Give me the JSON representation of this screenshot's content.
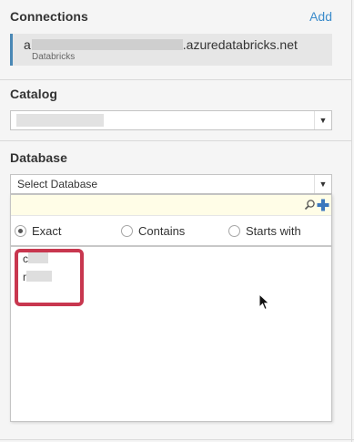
{
  "connections": {
    "header": "Connections",
    "add_label": "Add",
    "item": {
      "name_start": "a",
      "name_end": ".azuredatabricks.net",
      "type": "Databricks"
    }
  },
  "catalog": {
    "header": "Catalog",
    "selected_value": ""
  },
  "database": {
    "header": "Database",
    "placeholder": "Select Database",
    "search_value": "",
    "match_options": [
      {
        "label": "Exact",
        "selected": true
      },
      {
        "label": "Contains",
        "selected": false
      },
      {
        "label": "Starts with",
        "selected": false
      }
    ],
    "results": [
      {
        "initial": "c"
      },
      {
        "initial": "r"
      }
    ]
  },
  "colors": {
    "accent_link": "#3c8ccb",
    "connection_bar": "#4a88b5",
    "highlight_box": "#c8374f",
    "plus_icon": "#3b78bd",
    "search_row_bg": "#fffde7"
  }
}
